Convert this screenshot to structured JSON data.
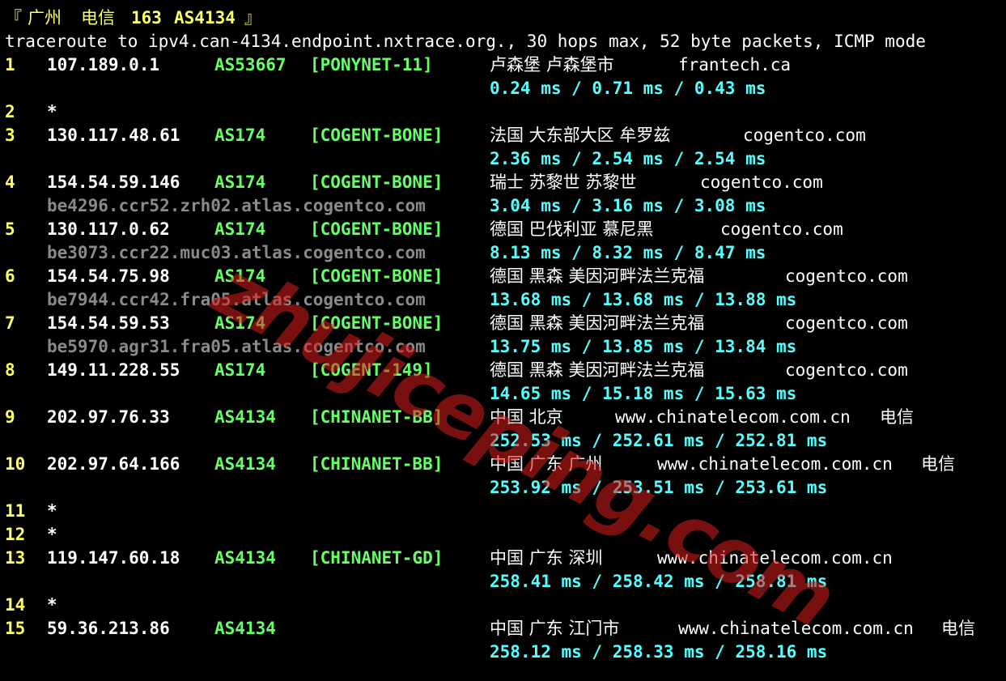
{
  "header": {
    "bracket_open": "『",
    "city": "广州",
    "isp": "电信",
    "num": "163",
    "asn": "AS4134",
    "bracket_close": "』"
  },
  "command": "traceroute to ipv4.can-4134.endpoint.nxtrace.org., 30 hops max, 52 byte packets, ICMP mode",
  "hops": [
    {
      "num": "1",
      "ip": "107.189.0.1",
      "asn": "AS53667",
      "tag": "[PONYNET-11]",
      "geo": "卢森堡 卢森堡市",
      "domain": "frantech.ca",
      "isp": "",
      "host": "",
      "rtt": "0.24 ms / 0.71 ms / 0.43 ms"
    },
    {
      "num": "2",
      "ip": "*"
    },
    {
      "num": "3",
      "ip": "130.117.48.61",
      "asn": "AS174",
      "tag": "[COGENT-BONE]",
      "geo": "法国 大东部大区 牟罗兹",
      "domain": "cogentco.com",
      "isp": "",
      "host": "",
      "rtt": "2.36 ms / 2.54 ms / 2.54 ms"
    },
    {
      "num": "4",
      "ip": "154.54.59.146",
      "asn": "AS174",
      "tag": "[COGENT-BONE]",
      "geo": "瑞士 苏黎世 苏黎世",
      "domain": "cogentco.com",
      "isp": "",
      "host": "be4296.ccr52.zrh02.atlas.cogentco.com",
      "rtt": "3.04 ms / 3.16 ms / 3.08 ms"
    },
    {
      "num": "5",
      "ip": "130.117.0.62",
      "asn": "AS174",
      "tag": "[COGENT-BONE]",
      "geo": "德国 巴伐利亚 慕尼黑",
      "domain": "cogentco.com",
      "isp": "",
      "host": "be3073.ccr22.muc03.atlas.cogentco.com",
      "rtt": "8.13 ms / 8.32 ms / 8.47 ms"
    },
    {
      "num": "6",
      "ip": "154.54.75.98",
      "asn": "AS174",
      "tag": "[COGENT-BONE]",
      "geo": "德国 黑森 美因河畔法兰克福",
      "domain": "cogentco.com",
      "isp": "",
      "host": "be7944.ccr42.fra05.atlas.cogentco.com",
      "rtt": "13.68 ms / 13.68 ms / 13.88 ms"
    },
    {
      "num": "7",
      "ip": "154.54.59.53",
      "asn": "AS174",
      "tag": "[COGENT-BONE]",
      "geo": "德国 黑森 美因河畔法兰克福",
      "domain": "cogentco.com",
      "isp": "",
      "host": "be5970.agr31.fra05.atlas.cogentco.com",
      "rtt": "13.75 ms / 13.85 ms / 13.84 ms"
    },
    {
      "num": "8",
      "ip": "149.11.228.55",
      "asn": "AS174",
      "tag": "[COGENT-149]",
      "geo": "德国 黑森 美因河畔法兰克福",
      "domain": "cogentco.com",
      "isp": "",
      "host": "",
      "rtt": "14.65 ms / 15.18 ms / 15.63 ms"
    },
    {
      "num": "9",
      "ip": "202.97.76.33",
      "asn": "AS4134",
      "tag": "[CHINANET-BB]",
      "geo": "中国 北京",
      "domain": "www.chinatelecom.com.cn",
      "isp": "电信",
      "host": "",
      "rtt": "252.53 ms / 252.61 ms / 252.81 ms"
    },
    {
      "num": "10",
      "ip": "202.97.64.166",
      "asn": "AS4134",
      "tag": "[CHINANET-BB]",
      "geo": "中国 广东 广州",
      "domain": "www.chinatelecom.com.cn",
      "isp": "电信",
      "host": "",
      "rtt": "253.92 ms / 253.51 ms / 253.61 ms"
    },
    {
      "num": "11",
      "ip": "*"
    },
    {
      "num": "12",
      "ip": "*"
    },
    {
      "num": "13",
      "ip": "119.147.60.18",
      "asn": "AS4134",
      "tag": "[CHINANET-GD]",
      "geo": "中国 广东 深圳",
      "domain": "www.chinatelecom.com.cn",
      "isp": "",
      "host": "",
      "rtt": "258.41 ms / 258.42 ms / 258.81 ms"
    },
    {
      "num": "14",
      "ip": "*"
    },
    {
      "num": "15",
      "ip": "59.36.213.86",
      "asn": "AS4134",
      "tag": "",
      "geo": "中国 广东 江门市",
      "domain": "www.chinatelecom.com.cn",
      "isp": "电信",
      "host": "",
      "rtt": "258.12 ms / 258.33 ms / 258.16 ms"
    }
  ],
  "watermark": "zhujiceping.com",
  "colors": {
    "hop_num": "#ffff66",
    "ip": "#ffffff",
    "asn": "#66ff66",
    "host": "#8a8a8a",
    "rtt": "#55ffff",
    "watermark": "#dc1e1e"
  }
}
